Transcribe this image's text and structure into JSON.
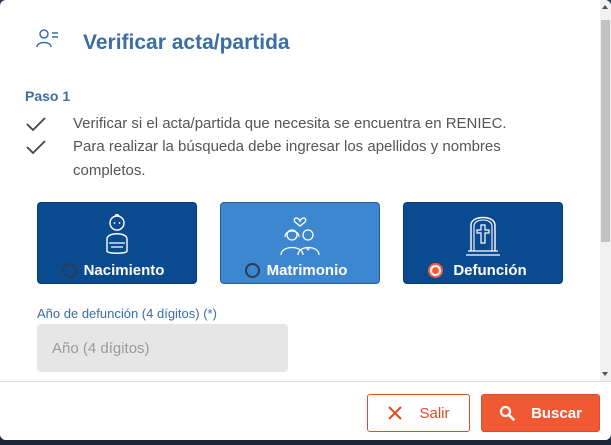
{
  "modal": {
    "title": "Verificar acta/partida",
    "header_icon": "user-list-icon"
  },
  "step": {
    "title": "Paso 1",
    "items": [
      "Verificar si el acta/partida que necesita se encuentra en RENIEC.",
      "Para realizar la búsqueda debe ingresar los apellidos y nombres completos."
    ]
  },
  "options": [
    {
      "label": "Nacimiento",
      "icon": "baby-icon",
      "selected": false
    },
    {
      "label": "Matrimonio",
      "icon": "couple-icon",
      "selected": false
    },
    {
      "label": "Defunción",
      "icon": "tombstone-icon",
      "selected": true
    }
  ],
  "field": {
    "label": "Año de defunción (4 dígitos) (*)",
    "placeholder": "Año (4 dígitos)",
    "value": ""
  },
  "footer": {
    "exit_label": "Salir",
    "search_label": "Buscar"
  },
  "colors": {
    "title": "#3a6ea5",
    "option_dark": "#0a4a8f",
    "option_light": "#3d86d0",
    "accent": "#ef5a35"
  }
}
